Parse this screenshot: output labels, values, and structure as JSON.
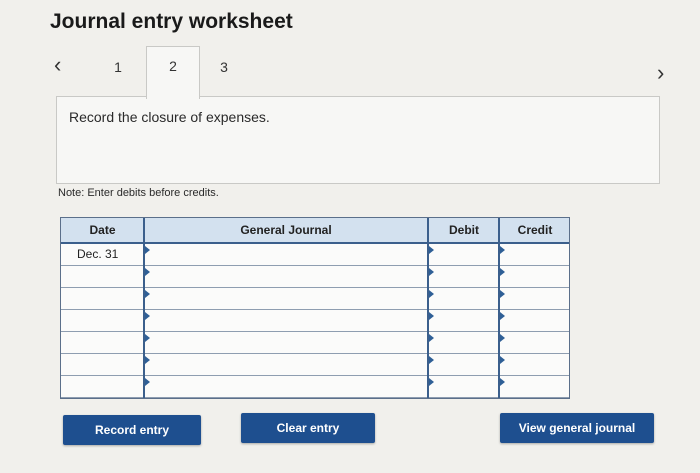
{
  "page": {
    "title": "Journal entry worksheet"
  },
  "nav": {
    "prev_icon": "‹",
    "next_icon": "›"
  },
  "tabs": [
    {
      "label": "1",
      "active": false
    },
    {
      "label": "2",
      "active": true
    },
    {
      "label": "3",
      "active": false
    }
  ],
  "instruction": "Record the closure of expenses.",
  "note": "Note: Enter debits before credits.",
  "journal": {
    "headers": {
      "date": "Date",
      "general_journal": "General Journal",
      "debit": "Debit",
      "credit": "Credit"
    },
    "rows": [
      {
        "date": "Dec. 31",
        "account": "",
        "debit": "",
        "credit": ""
      },
      {
        "date": "",
        "account": "",
        "debit": "",
        "credit": ""
      },
      {
        "date": "",
        "account": "",
        "debit": "",
        "credit": ""
      },
      {
        "date": "",
        "account": "",
        "debit": "",
        "credit": ""
      },
      {
        "date": "",
        "account": "",
        "debit": "",
        "credit": ""
      },
      {
        "date": "",
        "account": "",
        "debit": "",
        "credit": ""
      },
      {
        "date": "",
        "account": "",
        "debit": "",
        "credit": ""
      }
    ]
  },
  "buttons": {
    "record": "Record entry",
    "clear": "Clear entry",
    "view": "View general journal"
  },
  "colors": {
    "button_bg": "#1e4f8f",
    "header_bg": "#d3e1ef",
    "grid_line": "#3b5f8c",
    "page_bg": "#f1f0ec"
  }
}
